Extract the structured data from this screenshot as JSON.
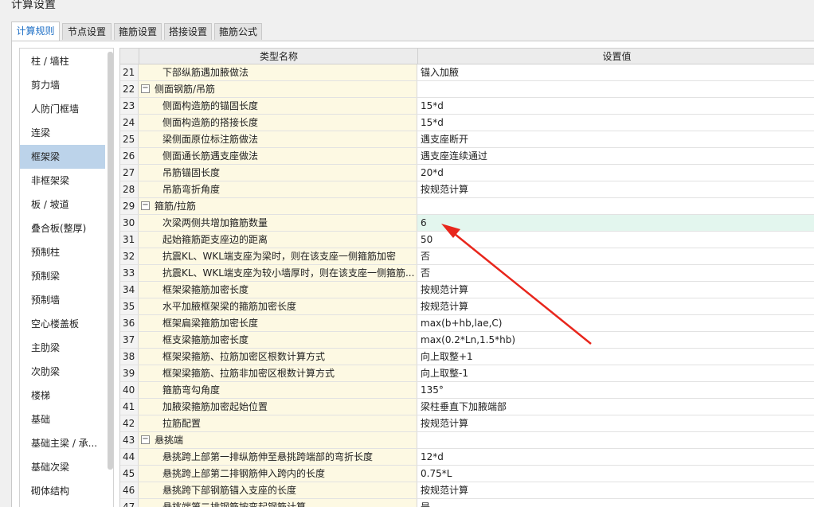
{
  "window": {
    "title": "计算设置"
  },
  "tabs": [
    {
      "label": "计算规则",
      "active": true
    },
    {
      "label": "节点设置",
      "active": false
    },
    {
      "label": "箍筋设置",
      "active": false
    },
    {
      "label": "搭接设置",
      "active": false
    },
    {
      "label": "箍筋公式",
      "active": false
    }
  ],
  "sidebar": {
    "items": [
      {
        "label": "柱 / 墙柱"
      },
      {
        "label": "剪力墙"
      },
      {
        "label": "人防门框墙"
      },
      {
        "label": "连梁"
      },
      {
        "label": "框架梁",
        "selected": true
      },
      {
        "label": "非框架梁"
      },
      {
        "label": "板 / 坡道"
      },
      {
        "label": "叠合板(整厚)"
      },
      {
        "label": "预制柱"
      },
      {
        "label": "预制梁"
      },
      {
        "label": "预制墙"
      },
      {
        "label": "空心楼盖板"
      },
      {
        "label": "主肋梁"
      },
      {
        "label": "次肋梁"
      },
      {
        "label": "楼梯"
      },
      {
        "label": "基础"
      },
      {
        "label": "基础主梁 / 承..."
      },
      {
        "label": "基础次梁"
      },
      {
        "label": "砌体结构"
      }
    ]
  },
  "table": {
    "headers": {
      "name": "类型名称",
      "value": "设置值"
    },
    "rows": [
      {
        "num": "21",
        "name": "下部纵筋遇加腋做法",
        "value": "锚入加腋"
      },
      {
        "num": "22",
        "name": "侧面钢筋/吊筋",
        "value": "",
        "group": true,
        "toggle": "−"
      },
      {
        "num": "23",
        "name": "侧面构造筋的锚固长度",
        "value": "15*d"
      },
      {
        "num": "24",
        "name": "侧面构造筋的搭接长度",
        "value": "15*d"
      },
      {
        "num": "25",
        "name": "梁侧面原位标注筋做法",
        "value": "遇支座断开"
      },
      {
        "num": "26",
        "name": "侧面通长筋遇支座做法",
        "value": "遇支座连续通过"
      },
      {
        "num": "27",
        "name": "吊筋锚固长度",
        "value": "20*d"
      },
      {
        "num": "28",
        "name": "吊筋弯折角度",
        "value": "按规范计算"
      },
      {
        "num": "29",
        "name": "箍筋/拉筋",
        "value": "",
        "group": true,
        "toggle": "−"
      },
      {
        "num": "30",
        "name": "次梁两侧共增加箍筋数量",
        "value": "6",
        "highlight": true
      },
      {
        "num": "31",
        "name": "起始箍筋距支座边的距离",
        "value": "50"
      },
      {
        "num": "32",
        "name": "抗震KL、WKL端支座为梁时，则在该支座一侧箍筋加密",
        "value": "否"
      },
      {
        "num": "33",
        "name": "抗震KL、WKL端支座为较小墙厚时，则在该支座一侧箍筋...",
        "value": "否"
      },
      {
        "num": "34",
        "name": "框架梁箍筋加密长度",
        "value": "按规范计算"
      },
      {
        "num": "35",
        "name": "水平加腋框架梁的箍筋加密长度",
        "value": "按规范计算"
      },
      {
        "num": "36",
        "name": "框架扁梁箍筋加密长度",
        "value": "max(b+hb,lae,C)"
      },
      {
        "num": "37",
        "name": "框支梁箍筋加密长度",
        "value": "max(0.2*Ln,1.5*hb)"
      },
      {
        "num": "38",
        "name": "框架梁箍筋、拉筋加密区根数计算方式",
        "value": "向上取整+1"
      },
      {
        "num": "39",
        "name": "框架梁箍筋、拉筋非加密区根数计算方式",
        "value": "向上取整-1"
      },
      {
        "num": "40",
        "name": "箍筋弯勾角度",
        "value": "135°"
      },
      {
        "num": "41",
        "name": "加腋梁箍筋加密起始位置",
        "value": "梁柱垂直下加腋端部"
      },
      {
        "num": "42",
        "name": "拉筋配置",
        "value": "按规范计算"
      },
      {
        "num": "43",
        "name": "悬挑端",
        "value": "",
        "group": true,
        "toggle": "−"
      },
      {
        "num": "44",
        "name": "悬挑跨上部第一排纵筋伸至悬挑跨端部的弯折长度",
        "value": "12*d"
      },
      {
        "num": "45",
        "name": "悬挑跨上部第二排钢筋伸入跨内的长度",
        "value": "0.75*L"
      },
      {
        "num": "46",
        "name": "悬挑跨下部钢筋锚入支座的长度",
        "value": "按规范计算"
      },
      {
        "num": "47",
        "name": "悬挑端第二排钢筋按弯起钢筋计算",
        "value": "是"
      }
    ]
  },
  "annotation": {
    "color": "#e8261c"
  }
}
